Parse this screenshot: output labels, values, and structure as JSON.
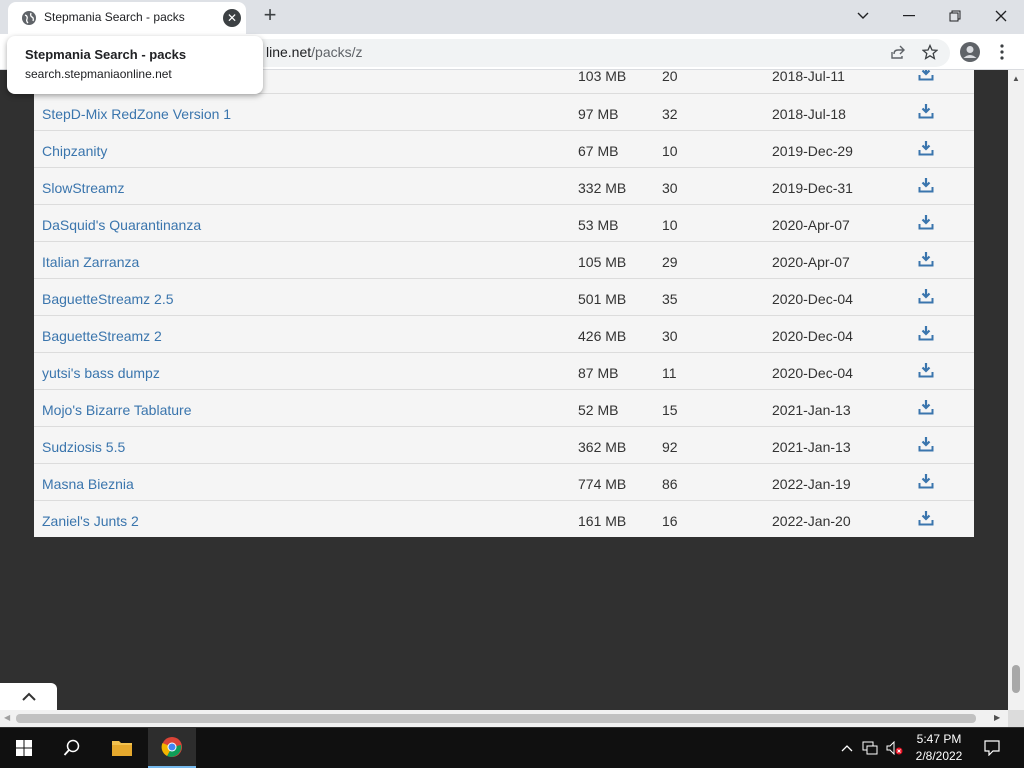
{
  "browser": {
    "tab": {
      "title": "Stepmania Search - packs"
    },
    "hovercard": {
      "title": "Stepmania Search - packs",
      "url": "search.stepmaniaonline.net"
    },
    "url": {
      "host_visible": "line.net",
      "path": "/packs/z"
    }
  },
  "packs": [
    {
      "name": "",
      "size": "103 MB",
      "songs": "20",
      "date": "2018-Jul-11"
    },
    {
      "name": "StepD-Mix RedZone Version 1",
      "size": "97 MB",
      "songs": "32",
      "date": "2018-Jul-18"
    },
    {
      "name": "Chipzanity",
      "size": "67 MB",
      "songs": "10",
      "date": "2019-Dec-29"
    },
    {
      "name": "SlowStreamz",
      "size": "332 MB",
      "songs": "30",
      "date": "2019-Dec-31"
    },
    {
      "name": "DaSquid's Quarantinanza",
      "size": "53 MB",
      "songs": "10",
      "date": "2020-Apr-07"
    },
    {
      "name": "Italian Zarranza",
      "size": "105 MB",
      "songs": "29",
      "date": "2020-Apr-07"
    },
    {
      "name": "BaguetteStreamz 2.5",
      "size": "501 MB",
      "songs": "35",
      "date": "2020-Dec-04"
    },
    {
      "name": "BaguetteStreamz 2",
      "size": "426 MB",
      "songs": "30",
      "date": "2020-Dec-04"
    },
    {
      "name": "yutsi's bass dumpz",
      "size": "87 MB",
      "songs": "11",
      "date": "2020-Dec-04"
    },
    {
      "name": "Mojo's Bizarre Tablature",
      "size": "52 MB",
      "songs": "15",
      "date": "2021-Jan-13"
    },
    {
      "name": "Sudziosis 5.5",
      "size": "362 MB",
      "songs": "92",
      "date": "2021-Jan-13"
    },
    {
      "name": "Masna Bieznia",
      "size": "774 MB",
      "songs": "86",
      "date": "2022-Jan-19"
    },
    {
      "name": "Zaniel's Junts 2",
      "size": "161 MB",
      "songs": "16",
      "date": "2022-Jan-20"
    }
  ],
  "taskbar": {
    "time": "5:47 PM",
    "date": "2/8/2022"
  },
  "colors": {
    "link": "#3a75ad",
    "page_bg": "#303030",
    "table_bg": "#f5f5f5"
  }
}
